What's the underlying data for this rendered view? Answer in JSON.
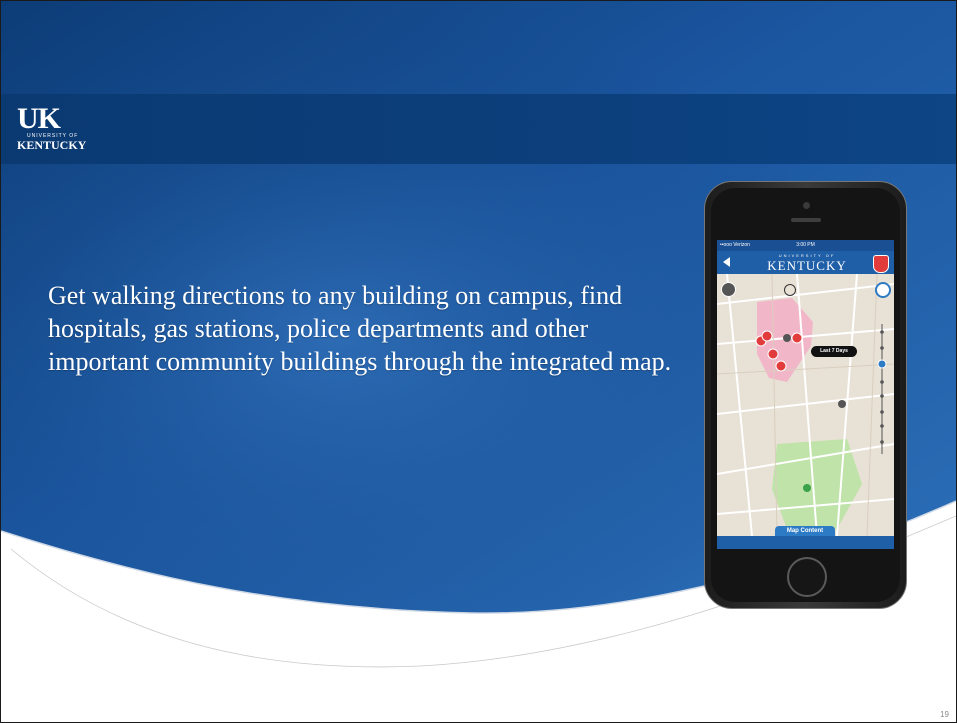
{
  "slide": {
    "body_text": "Get walking directions to any building on campus, find hospitals, gas stations, police departments and other important community buildings through the integrated map.",
    "page_number": "19"
  },
  "logo": {
    "uk": "UK",
    "university_of": "UNIVERSITY OF",
    "kentucky": "KENTUCKY"
  },
  "phone_app": {
    "brand_small": "UNIVERSITY OF",
    "brand_large": "KENTUCKY",
    "time_filter": "Last 7 Days",
    "map_content_label": "Map Content",
    "status_time": "3:00 PM",
    "status_carrier": "••ooo Verizon"
  },
  "colors": {
    "slide_blue_dark": "#0b3a72",
    "slide_blue_mid": "#1d5aa0",
    "app_header": "#1f5fa8",
    "accent_red": "#e23b3b"
  },
  "icons": [
    "back-arrow-icon",
    "shield-icon",
    "locate-icon",
    "crosshair-icon",
    "clock-icon",
    "hospital-marker-icon"
  ]
}
